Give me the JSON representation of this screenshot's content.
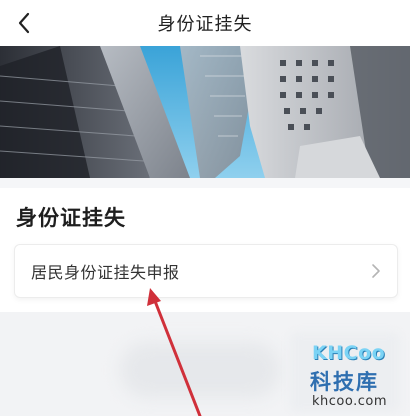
{
  "header": {
    "title": "身份证挂失",
    "back_icon": "chevron-left-icon"
  },
  "banner": {
    "description_tag": "city-buildings-photo"
  },
  "section": {
    "title": "身份证挂失",
    "items": [
      {
        "label": "居民身份证挂失申报",
        "icon": "chevron-right-icon"
      }
    ]
  },
  "annotation": {
    "arrow_color": "#d0303a"
  },
  "watermark": {
    "logo": "KHCoo",
    "name": "科技库",
    "url": "khcoo.com"
  }
}
